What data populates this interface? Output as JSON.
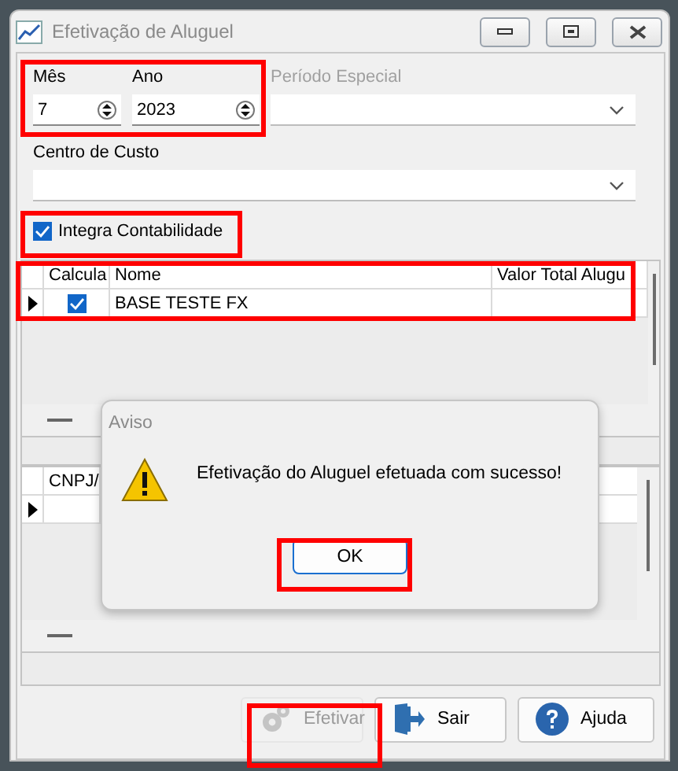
{
  "window": {
    "title": "Efetivação de Aluguel"
  },
  "fields": {
    "month": {
      "label": "Mês",
      "value": "7"
    },
    "year": {
      "label": "Ano",
      "value": "2023"
    },
    "special_period": {
      "label": "Período Especial",
      "disabled": true
    },
    "cost_center": {
      "label": "Centro de Custo"
    }
  },
  "integra_contabilidade": {
    "label": "Integra Contabilidade",
    "checked": true
  },
  "grid_1": {
    "columns": [
      "Calcula",
      "Nome",
      "Valor Total Alugu"
    ],
    "rows": [
      {
        "current": true,
        "calcula": true,
        "nome": "BASE TESTE FX"
      }
    ]
  },
  "grid_2": {
    "columns": [
      "CNPJ/"
    ],
    "rows": [
      {
        "current": true
      }
    ]
  },
  "dialog": {
    "title": "Aviso",
    "message": "Efetivação do Aluguel efetuada com sucesso!",
    "button": "OK"
  },
  "buttons": [
    {
      "label": "Efetivar",
      "disabled": true,
      "kind": "run"
    },
    {
      "label": "Sair",
      "disabled": false,
      "kind": "exit"
    },
    {
      "label": "Ajuda",
      "disabled": false,
      "kind": "help"
    }
  ]
}
